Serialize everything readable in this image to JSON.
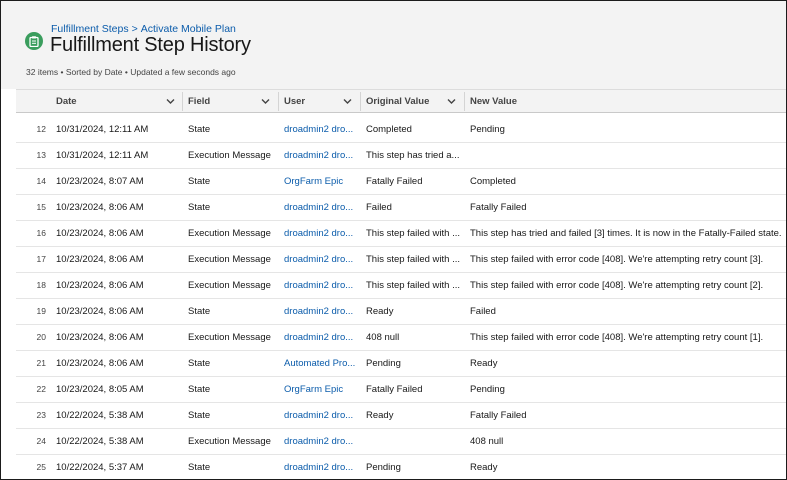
{
  "breadcrumb": {
    "parent": "Fulfillment Steps",
    "separator": ">",
    "current": "Activate Mobile Plan"
  },
  "page_title": "Fulfillment Step History",
  "meta": "32 items • Sorted by Date • Updated a few seconds ago",
  "icon": "page-clipboard-icon",
  "accent": "#3a9d5d",
  "link_color": "#0b5cab",
  "columns": {
    "date": "Date",
    "field": "Field",
    "user": "User",
    "original": "Original Value",
    "new": "New Value"
  },
  "rows": [
    {
      "n": "12",
      "date": "10/31/2024, 12:11 AM",
      "field": "State",
      "user": "droadmin2 dro...",
      "original": "Completed",
      "new": "Pending"
    },
    {
      "n": "13",
      "date": "10/31/2024, 12:11 AM",
      "field": "Execution Message",
      "user": "droadmin2 dro...",
      "original": "This step has tried a...",
      "new": ""
    },
    {
      "n": "14",
      "date": "10/23/2024, 8:07 AM",
      "field": "State",
      "user": "OrgFarm Epic",
      "original": "Fatally Failed",
      "new": "Completed"
    },
    {
      "n": "15",
      "date": "10/23/2024, 8:06 AM",
      "field": "State",
      "user": "droadmin2 dro...",
      "original": "Failed",
      "new": "Fatally Failed"
    },
    {
      "n": "16",
      "date": "10/23/2024, 8:06 AM",
      "field": "Execution Message",
      "user": "droadmin2 dro...",
      "original": "This step failed with ...",
      "new": "This step has tried and failed [3] times. It is now in the Fatally-Failed state."
    },
    {
      "n": "17",
      "date": "10/23/2024, 8:06 AM",
      "field": "Execution Message",
      "user": "droadmin2 dro...",
      "original": "This step failed with ...",
      "new": "This step failed with error code [408]. We're attempting retry count [3]."
    },
    {
      "n": "18",
      "date": "10/23/2024, 8:06 AM",
      "field": "Execution Message",
      "user": "droadmin2 dro...",
      "original": "This step failed with ...",
      "new": "This step failed with error code [408]. We're attempting retry count [2]."
    },
    {
      "n": "19",
      "date": "10/23/2024, 8:06 AM",
      "field": "State",
      "user": "droadmin2 dro...",
      "original": "Ready",
      "new": "Failed"
    },
    {
      "n": "20",
      "date": "10/23/2024, 8:06 AM",
      "field": "Execution Message",
      "user": "droadmin2 dro...",
      "original": "408 null",
      "new": "This step failed with error code [408]. We're attempting retry count [1]."
    },
    {
      "n": "21",
      "date": "10/23/2024, 8:06 AM",
      "field": "State",
      "user": "Automated Pro...",
      "original": "Pending",
      "new": "Ready"
    },
    {
      "n": "22",
      "date": "10/23/2024, 8:05 AM",
      "field": "State",
      "user": "OrgFarm Epic",
      "original": "Fatally Failed",
      "new": "Pending"
    },
    {
      "n": "23",
      "date": "10/22/2024, 5:38 AM",
      "field": "State",
      "user": "droadmin2 dro...",
      "original": "Ready",
      "new": "Fatally Failed"
    },
    {
      "n": "24",
      "date": "10/22/2024, 5:38 AM",
      "field": "Execution Message",
      "user": "droadmin2 dro...",
      "original": "",
      "new": "408 null"
    },
    {
      "n": "25",
      "date": "10/22/2024, 5:37 AM",
      "field": "State",
      "user": "droadmin2 dro...",
      "original": "Pending",
      "new": "Ready"
    }
  ]
}
